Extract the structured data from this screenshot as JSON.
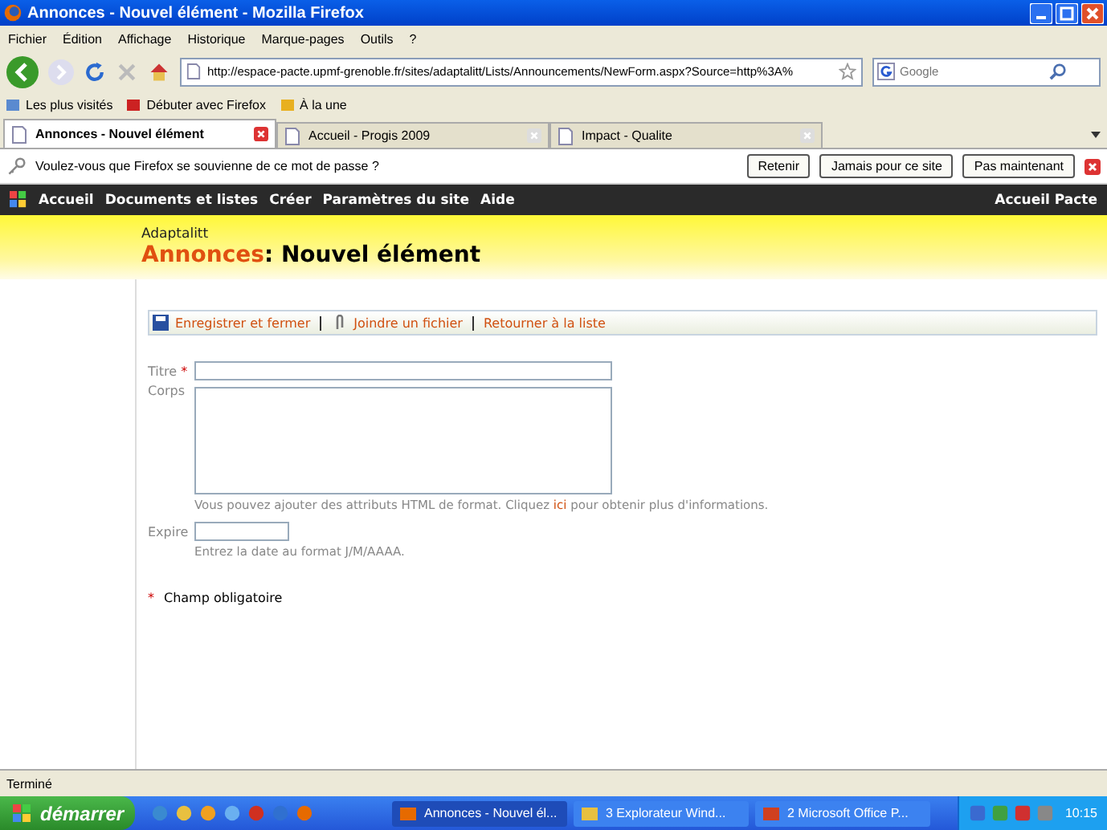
{
  "window": {
    "title": "Annonces - Nouvel élément - Mozilla Firefox"
  },
  "menu": [
    "Fichier",
    "Édition",
    "Affichage",
    "Historique",
    "Marque-pages",
    "Outils",
    "?"
  ],
  "address": {
    "value": "http://espace-pacte.upmf-grenoble.fr/sites/adaptalitt/Lists/Announcements/NewForm.aspx?Source=http%3A%"
  },
  "search": {
    "placeholder": "Google"
  },
  "bookmarks": [
    "Les plus visités",
    "Débuter avec Firefox",
    "À la une"
  ],
  "tabs": [
    {
      "label": "Annonces - Nouvel élément",
      "selected": true
    },
    {
      "label": "Accueil - Progis 2009",
      "selected": false
    },
    {
      "label": "Impact - Qualite",
      "selected": false
    }
  ],
  "password_bar": {
    "message": "Voulez-vous que Firefox se souvienne de ce mot de passe ?",
    "buttons": [
      "Retenir",
      "Jamais pour ce site",
      "Pas maintenant"
    ]
  },
  "site_nav": {
    "items": [
      "Accueil",
      "Documents et listes",
      "Créer",
      "Paramètres du site",
      "Aide"
    ],
    "right": "Accueil Pacte"
  },
  "header": {
    "site": "Adaptalitt",
    "list": "Annonces",
    "separator": ":",
    "title": "Nouvel élément"
  },
  "toolbar": [
    "Enregistrer et fermer",
    "Joindre un fichier",
    "Retourner à la liste"
  ],
  "form": {
    "title_label": "Titre",
    "required_mark": "*",
    "body_label": "Corps",
    "body_hint_before": "Vous pouvez ajouter des attributs HTML de format. Cliquez",
    "body_hint_link": "ici",
    "body_hint_after": "pour obtenir plus d'informations.",
    "expire_label": "Expire",
    "expire_hint": "Entrez la date au format J/M/AAAA.",
    "required_note": "Champ obligatoire"
  },
  "status_bar": "Terminé",
  "taskbar": {
    "start": "démarrer",
    "tasks": [
      {
        "label": "Annonces - Nouvel él...",
        "selected": true
      },
      {
        "label": "3 Explorateur Wind...",
        "selected": false
      },
      {
        "label": "2 Microsoft Office P...",
        "selected": false
      }
    ],
    "clock": "10:15"
  }
}
